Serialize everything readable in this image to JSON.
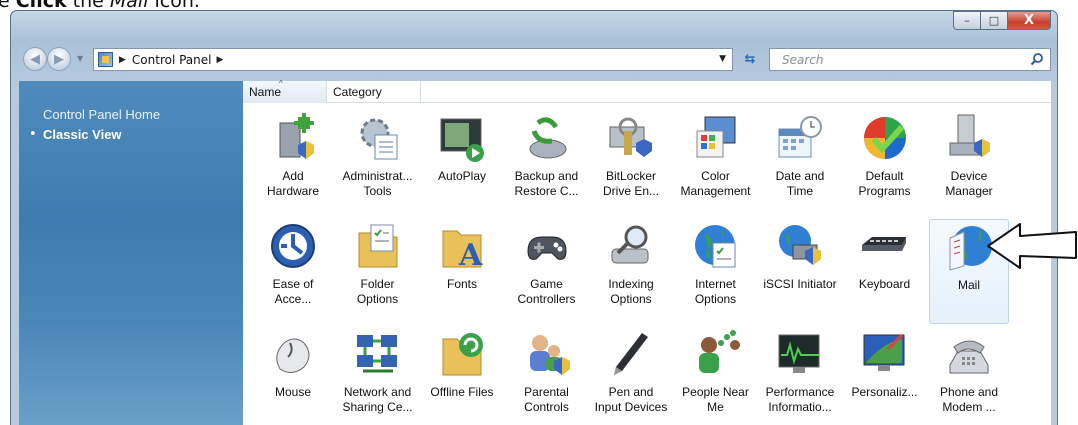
{
  "instruction": {
    "prefix": "e ",
    "verb": "Click",
    "middle": " the ",
    "target": "Mail",
    "suffix": " icon."
  },
  "window": {
    "buttons": {
      "minimize": "–",
      "maximize": "□",
      "close": "X"
    }
  },
  "navbar": {
    "breadcrumb": "Control Panel",
    "search_placeholder": "Search"
  },
  "sidebar": {
    "home": "Control Panel Home",
    "classic_view": "Classic View"
  },
  "columns": {
    "name": "Name",
    "category": "Category"
  },
  "items": [
    {
      "label": "Add\nHardware",
      "icon": "add-hardware-icon"
    },
    {
      "label": "Administrat...\nTools",
      "icon": "administrative-tools-icon"
    },
    {
      "label": "AutoPlay",
      "icon": "autoplay-icon"
    },
    {
      "label": "Backup and\nRestore C...",
      "icon": "backup-icon"
    },
    {
      "label": "BitLocker\nDrive En...",
      "icon": "bitlocker-icon"
    },
    {
      "label": "Color\nManagement",
      "icon": "color-management-icon"
    },
    {
      "label": "Date and\nTime",
      "icon": "date-time-icon"
    },
    {
      "label": "Default\nPrograms",
      "icon": "default-programs-icon"
    },
    {
      "label": "Device\nManager",
      "icon": "device-manager-icon"
    },
    {
      "label": "Ease of\nAcce...",
      "icon": "ease-of-access-icon"
    },
    {
      "label": "Folder\nOptions",
      "icon": "folder-options-icon"
    },
    {
      "label": "Fonts",
      "icon": "fonts-icon"
    },
    {
      "label": "Game\nControllers",
      "icon": "game-controllers-icon"
    },
    {
      "label": "Indexing\nOptions",
      "icon": "indexing-options-icon"
    },
    {
      "label": "Internet\nOptions",
      "icon": "internet-options-icon"
    },
    {
      "label": "iSCSI Initiator",
      "icon": "iscsi-initiator-icon"
    },
    {
      "label": "Keyboard",
      "icon": "keyboard-icon"
    },
    {
      "label": "Mail",
      "icon": "mail-icon"
    },
    {
      "label": "Mouse",
      "icon": "mouse-icon"
    },
    {
      "label": "Network and\nSharing Ce...",
      "icon": "network-sharing-icon"
    },
    {
      "label": "Offline Files",
      "icon": "offline-files-icon"
    },
    {
      "label": "Parental\nControls",
      "icon": "parental-controls-icon"
    },
    {
      "label": "Pen and\nInput Devices",
      "icon": "pen-input-icon"
    },
    {
      "label": "People Near\nMe",
      "icon": "people-near-me-icon"
    },
    {
      "label": "Performance\nInformatio...",
      "icon": "performance-icon"
    },
    {
      "label": "Personaliz...",
      "icon": "personalization-icon"
    },
    {
      "label": "Phone and\nModem ...",
      "icon": "phone-modem-icon"
    }
  ]
}
